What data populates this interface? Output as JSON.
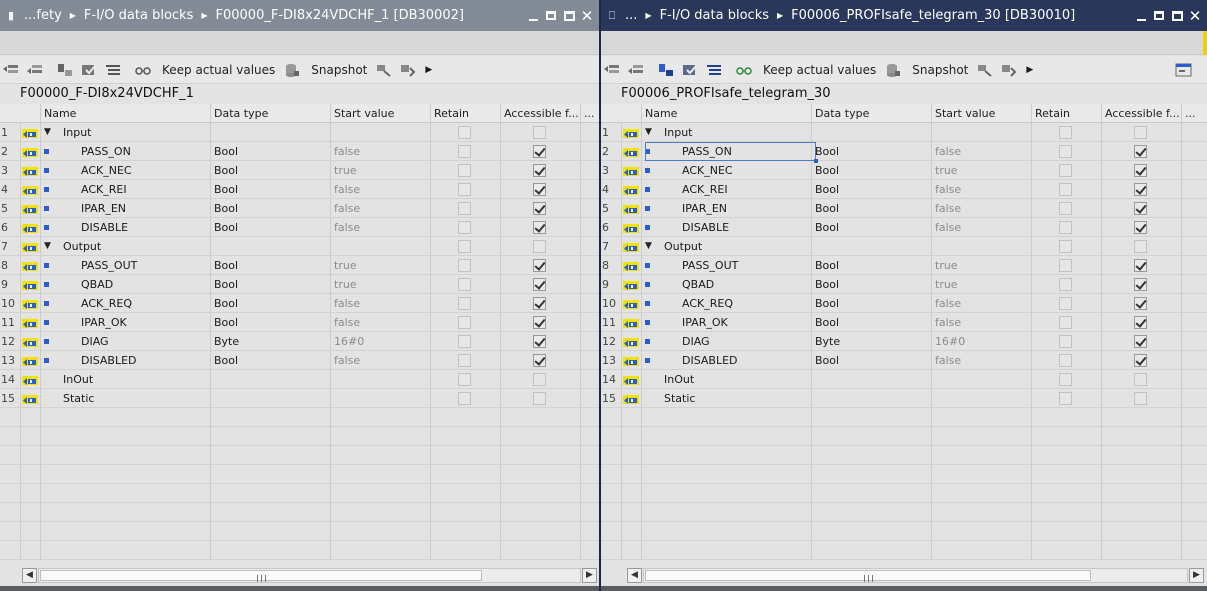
{
  "left": {
    "breadcrumb": [
      "...fety",
      "F-I/O data blocks",
      "F00000_F-DI8x24VDCHF_1 [DB30002]"
    ],
    "db_name": "F00000_F-DI8x24VDCHF_1",
    "toolbar": {
      "keep_actual_values": "Keep actual values",
      "snapshot": "Snapshot"
    },
    "columns": [
      "Name",
      "Data type",
      "Start value",
      "Retain",
      "Accessible f...",
      "..."
    ],
    "rows": [
      {
        "num": "1",
        "kind": "section",
        "name": "Input",
        "type": "",
        "start": "",
        "access": false
      },
      {
        "num": "2",
        "kind": "member",
        "name": "PASS_ON",
        "type": "Bool",
        "start": "false",
        "access": true
      },
      {
        "num": "3",
        "kind": "member",
        "name": "ACK_NEC",
        "type": "Bool",
        "start": "true",
        "access": true
      },
      {
        "num": "4",
        "kind": "member",
        "name": "ACK_REI",
        "type": "Bool",
        "start": "false",
        "access": true
      },
      {
        "num": "5",
        "kind": "member",
        "name": "IPAR_EN",
        "type": "Bool",
        "start": "false",
        "access": true
      },
      {
        "num": "6",
        "kind": "member",
        "name": "DISABLE",
        "type": "Bool",
        "start": "false",
        "access": true
      },
      {
        "num": "7",
        "kind": "section",
        "name": "Output",
        "type": "",
        "start": "",
        "access": false
      },
      {
        "num": "8",
        "kind": "member",
        "name": "PASS_OUT",
        "type": "Bool",
        "start": "true",
        "access": true
      },
      {
        "num": "9",
        "kind": "member",
        "name": "QBAD",
        "type": "Bool",
        "start": "true",
        "access": true
      },
      {
        "num": "10",
        "kind": "member",
        "name": "ACK_REQ",
        "type": "Bool",
        "start": "false",
        "access": true
      },
      {
        "num": "11",
        "kind": "member",
        "name": "IPAR_OK",
        "type": "Bool",
        "start": "false",
        "access": true
      },
      {
        "num": "12",
        "kind": "member",
        "name": "DIAG",
        "type": "Byte",
        "start": "16#0",
        "access": true
      },
      {
        "num": "13",
        "kind": "member",
        "name": "DISABLED",
        "type": "Bool",
        "start": "false",
        "access": true
      },
      {
        "num": "14",
        "kind": "plain",
        "name": "InOut",
        "type": "",
        "start": "",
        "access": false
      },
      {
        "num": "15",
        "kind": "plain",
        "name": "Static",
        "type": "",
        "start": "",
        "access": false
      }
    ]
  },
  "right": {
    "breadcrumb": [
      "...",
      "F-I/O data blocks",
      "F00006_PROFIsafe_telegram_30 [DB30010]"
    ],
    "db_name": "F00006_PROFIsafe_telegram_30",
    "toolbar": {
      "keep_actual_values": "Keep actual values",
      "snapshot": "Snapshot"
    },
    "columns": [
      "Name",
      "Data type",
      "Start value",
      "Retain",
      "Accessible f...",
      "..."
    ],
    "rows": [
      {
        "num": "1",
        "kind": "section",
        "name": "Input",
        "type": "",
        "start": "",
        "access": false
      },
      {
        "num": "2",
        "kind": "member",
        "name": "PASS_ON",
        "type": "Bool",
        "start": "false",
        "access": true
      },
      {
        "num": "3",
        "kind": "member",
        "name": "ACK_NEC",
        "type": "Bool",
        "start": "true",
        "access": true
      },
      {
        "num": "4",
        "kind": "member",
        "name": "ACK_REI",
        "type": "Bool",
        "start": "false",
        "access": true
      },
      {
        "num": "5",
        "kind": "member",
        "name": "IPAR_EN",
        "type": "Bool",
        "start": "false",
        "access": true
      },
      {
        "num": "6",
        "kind": "member",
        "name": "DISABLE",
        "type": "Bool",
        "start": "false",
        "access": true
      },
      {
        "num": "7",
        "kind": "section",
        "name": "Output",
        "type": "",
        "start": "",
        "access": false
      },
      {
        "num": "8",
        "kind": "member",
        "name": "PASS_OUT",
        "type": "Bool",
        "start": "true",
        "access": true
      },
      {
        "num": "9",
        "kind": "member",
        "name": "QBAD",
        "type": "Bool",
        "start": "true",
        "access": true
      },
      {
        "num": "10",
        "kind": "member",
        "name": "ACK_REQ",
        "type": "Bool",
        "start": "false",
        "access": true
      },
      {
        "num": "11",
        "kind": "member",
        "name": "IPAR_OK",
        "type": "Bool",
        "start": "false",
        "access": true
      },
      {
        "num": "12",
        "kind": "member",
        "name": "DIAG",
        "type": "Byte",
        "start": "16#0",
        "access": true
      },
      {
        "num": "13",
        "kind": "member",
        "name": "DISABLED",
        "type": "Bool",
        "start": "false",
        "access": true
      },
      {
        "num": "14",
        "kind": "plain",
        "name": "InOut",
        "type": "",
        "start": "",
        "access": false
      },
      {
        "num": "15",
        "kind": "plain",
        "name": "Static",
        "type": "",
        "start": "",
        "access": false
      }
    ]
  },
  "icons": {
    "row_icon": "interface-row-icon",
    "expand": "expand-triangle-icon",
    "member": "member-bullet-icon"
  },
  "colors": {
    "active_title": "#28375a",
    "inactive_title": "#838c96",
    "row_icon_blue": "#2b5ec8",
    "row_icon_yellow": "#f2e200"
  }
}
